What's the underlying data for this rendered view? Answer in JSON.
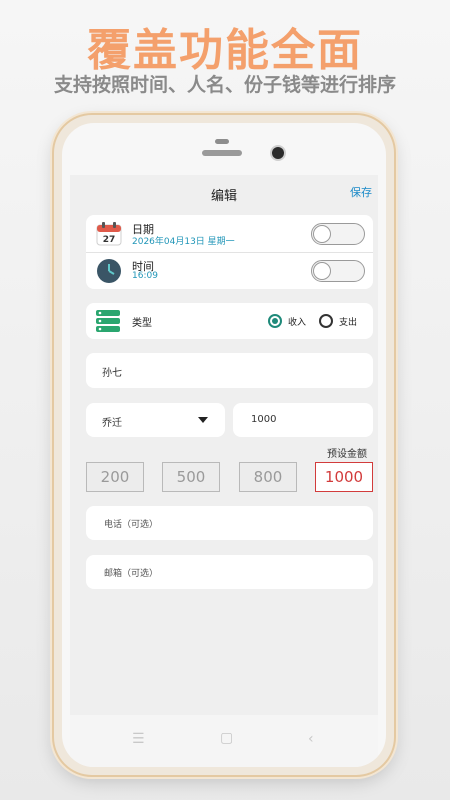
{
  "promo": {
    "headline": "覆盖功能全面",
    "subline": "支持按照时间、人名、份子钱等进行排序"
  },
  "app": {
    "title": "编辑",
    "save_label": "保存",
    "date": {
      "label": "日期",
      "value": "2026年04月13日 星期一",
      "icon_day": "27"
    },
    "time": {
      "label": "时间",
      "value": "16:09"
    },
    "category": {
      "label": "类型",
      "option_income": "收入",
      "option_expense": "支出",
      "selected": "收入"
    },
    "name_field": {
      "value": "孙七"
    },
    "event_select": {
      "value": "乔迁"
    },
    "amount_field": {
      "value": "1000"
    },
    "preset_title": "预设金额",
    "presets": [
      "200",
      "500",
      "800",
      "1000"
    ],
    "phone_field": {
      "placeholder": "电话（可选）"
    },
    "email_field": {
      "placeholder": "邮箱（可选）"
    }
  },
  "icons": {
    "calendar": "calendar-icon",
    "clock": "clock-icon",
    "category": "stack-icon",
    "dropdown": "caret-down-icon",
    "nav": [
      "menu-icon",
      "home-icon",
      "back-icon"
    ]
  },
  "colors": {
    "headline": "#f4a06c",
    "accent_blue": "#1b8ac8",
    "radio_green": "#1f8a7a",
    "selected_red": "#d23b3b"
  }
}
